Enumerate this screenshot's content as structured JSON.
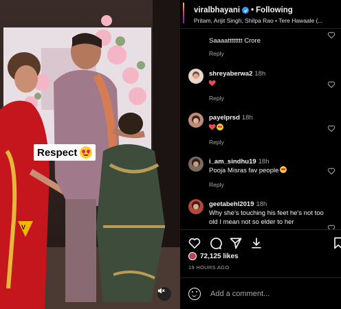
{
  "header": {
    "username": "viralbhayani",
    "separator": "•",
    "follow_label": "Following",
    "audio": "Pritam, Arijit Singh, Shilpa Rao • Tere Hawaale (..."
  },
  "media": {
    "sticker_text": "Respect",
    "sticker_emoji": "heart-eyes-emoji",
    "mute_icon": "muted-speaker-icon"
  },
  "comments": [
    {
      "username": "",
      "time": "",
      "text": "Saaaatttttttt Crore",
      "reply": "Reply"
    },
    {
      "username": "shreyaberwa2",
      "time": "18h",
      "text": "",
      "reply": "Reply",
      "emoji": "red-heart"
    },
    {
      "username": "payelprsd",
      "time": "18h",
      "text": "",
      "reply": "Reply",
      "emoji": "red-heart heart-eyes"
    },
    {
      "username": "i_am_sindhu19",
      "time": "18h",
      "text": "Pooja Misras fav people",
      "reply": "Reply",
      "emoji": "heart-eyes"
    },
    {
      "username": "geetabehl2019",
      "time": "18h",
      "text": "Why she's touching his feet he's not too old I mean not so elder to her",
      "reply": ""
    }
  ],
  "post_actions": {
    "likes": "72,125 likes",
    "time_ago": "19 HOURS AGO"
  },
  "add_comment": {
    "placeholder": "Add a comment..."
  },
  "colors": {
    "accent_blue": "#3897f0",
    "heart_red": "#ed4956",
    "muted_text": "#a8a8a8"
  }
}
